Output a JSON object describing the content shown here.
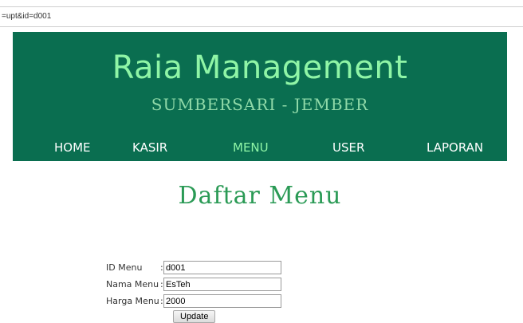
{
  "browser": {
    "url_fragment": "=upt&id=d001"
  },
  "header": {
    "title": "Raia Management",
    "subtitle": "SUMBERSARI - JEMBER",
    "background": "#0a6e50",
    "accent": "#8ff5a6"
  },
  "nav": {
    "items": [
      {
        "label": "HOME"
      },
      {
        "label": "KASIR"
      },
      {
        "label": "MENU",
        "active": true
      },
      {
        "label": "USER"
      },
      {
        "label": "LAPORAN"
      }
    ]
  },
  "page": {
    "heading": "Daftar Menu"
  },
  "form": {
    "fields": [
      {
        "label": "ID Menu",
        "value": "d001"
      },
      {
        "label": "Nama Menu",
        "value": "EsTeh"
      },
      {
        "label": "Harga Menu",
        "value": "2000"
      }
    ],
    "separator": ":",
    "submit_label": "Update"
  }
}
